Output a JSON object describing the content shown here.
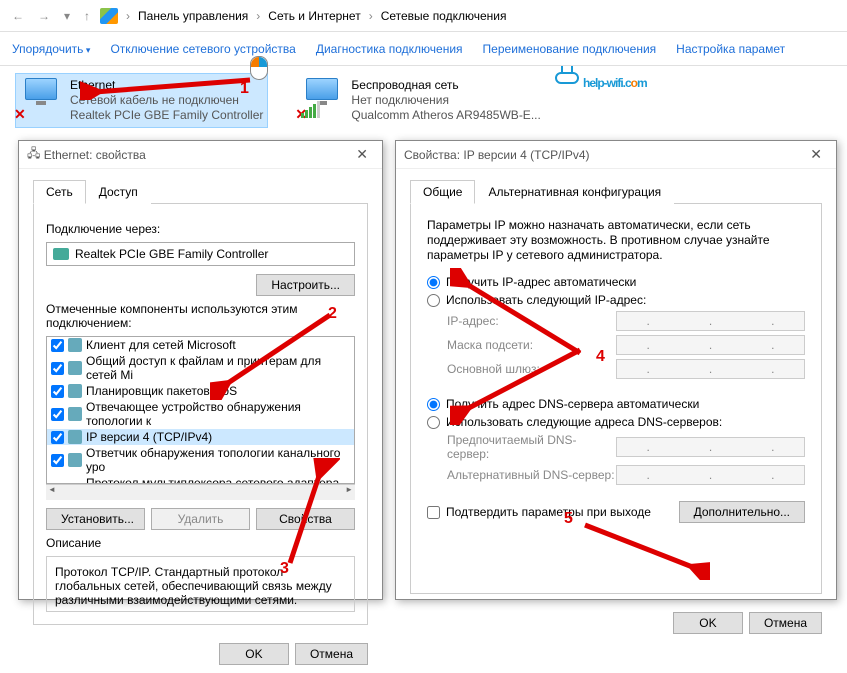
{
  "breadcrumb": {
    "root": "Панель управления",
    "l1": "Сеть и Интернет",
    "l2": "Сетевые подключения"
  },
  "toolbar": {
    "organize": "Упорядочить",
    "disable": "Отключение сетевого устройства",
    "diag": "Диагностика подключения",
    "rename": "Переименование подключения",
    "settings": "Настройка парамет"
  },
  "conn1": {
    "name": "Ethernet",
    "status": "Сетевой кабель не подключен",
    "dev": "Realtek PCIe GBE Family Controller"
  },
  "conn2": {
    "name": "Беспроводная сеть",
    "status": "Нет подключения",
    "dev": "Qualcomm Atheros AR9485WB-E..."
  },
  "watermark": "help-wifi.c",
  "watermark_o": "o",
  "watermark_m": "m",
  "dlg1": {
    "title": "Ethernet: свойства",
    "tab_net": "Сеть",
    "tab_access": "Доступ",
    "conn_via": "Подключение через:",
    "adapter": "Realtek PCIe GBE Family Controller",
    "configure": "Настроить...",
    "components_lbl": "Отмеченные компоненты используются этим подключением:",
    "items": [
      "Клиент для сетей Microsoft",
      "Общий доступ к файлам и принтерам для сетей Mi",
      "Планировщик пакетов QoS",
      "Отвечающее устройство обнаружения топологии к",
      "IP версии 4 (TCP/IPv4)",
      "Ответчик обнаружения топологии канального уро",
      "Протокол мультиплексора сетевого адаптера (Ma"
    ],
    "install": "Установить...",
    "remove": "Удалить",
    "props": "Свойства",
    "desc_lbl": "Описание",
    "desc": "Протокол TCP/IP. Стандартный протокол глобальных сетей, обеспечивающий связь между различными взаимодействующими сетями.",
    "ok": "OK",
    "cancel": "Отмена"
  },
  "dlg2": {
    "title": "Свойства: IP версии 4 (TCP/IPv4)",
    "tab_general": "Общие",
    "tab_alt": "Альтернативная конфигурация",
    "info": "Параметры IP можно назначать автоматически, если сеть поддерживает эту возможность. В противном случае узнайте параметры IP у сетевого администратора.",
    "ip_auto": "Получить IP-адрес автоматически",
    "ip_manual": "Использовать следующий IP-адрес:",
    "ip_addr": "IP-адрес:",
    "mask": "Маска подсети:",
    "gw": "Основной шлюз:",
    "dns_auto": "Получить адрес DNS-сервера автоматически",
    "dns_manual": "Использовать следующие адреса DNS-серверов:",
    "dns1": "Предпочитаемый DNS-сервер:",
    "dns2": "Альтернативный DNS-сервер:",
    "confirm": "Подтвердить параметры при выходе",
    "advanced": "Дополнительно...",
    "ok": "OK",
    "cancel": "Отмена"
  },
  "nums": {
    "n1": "1",
    "n2": "2",
    "n3": "3",
    "n4": "4",
    "n5": "5"
  }
}
